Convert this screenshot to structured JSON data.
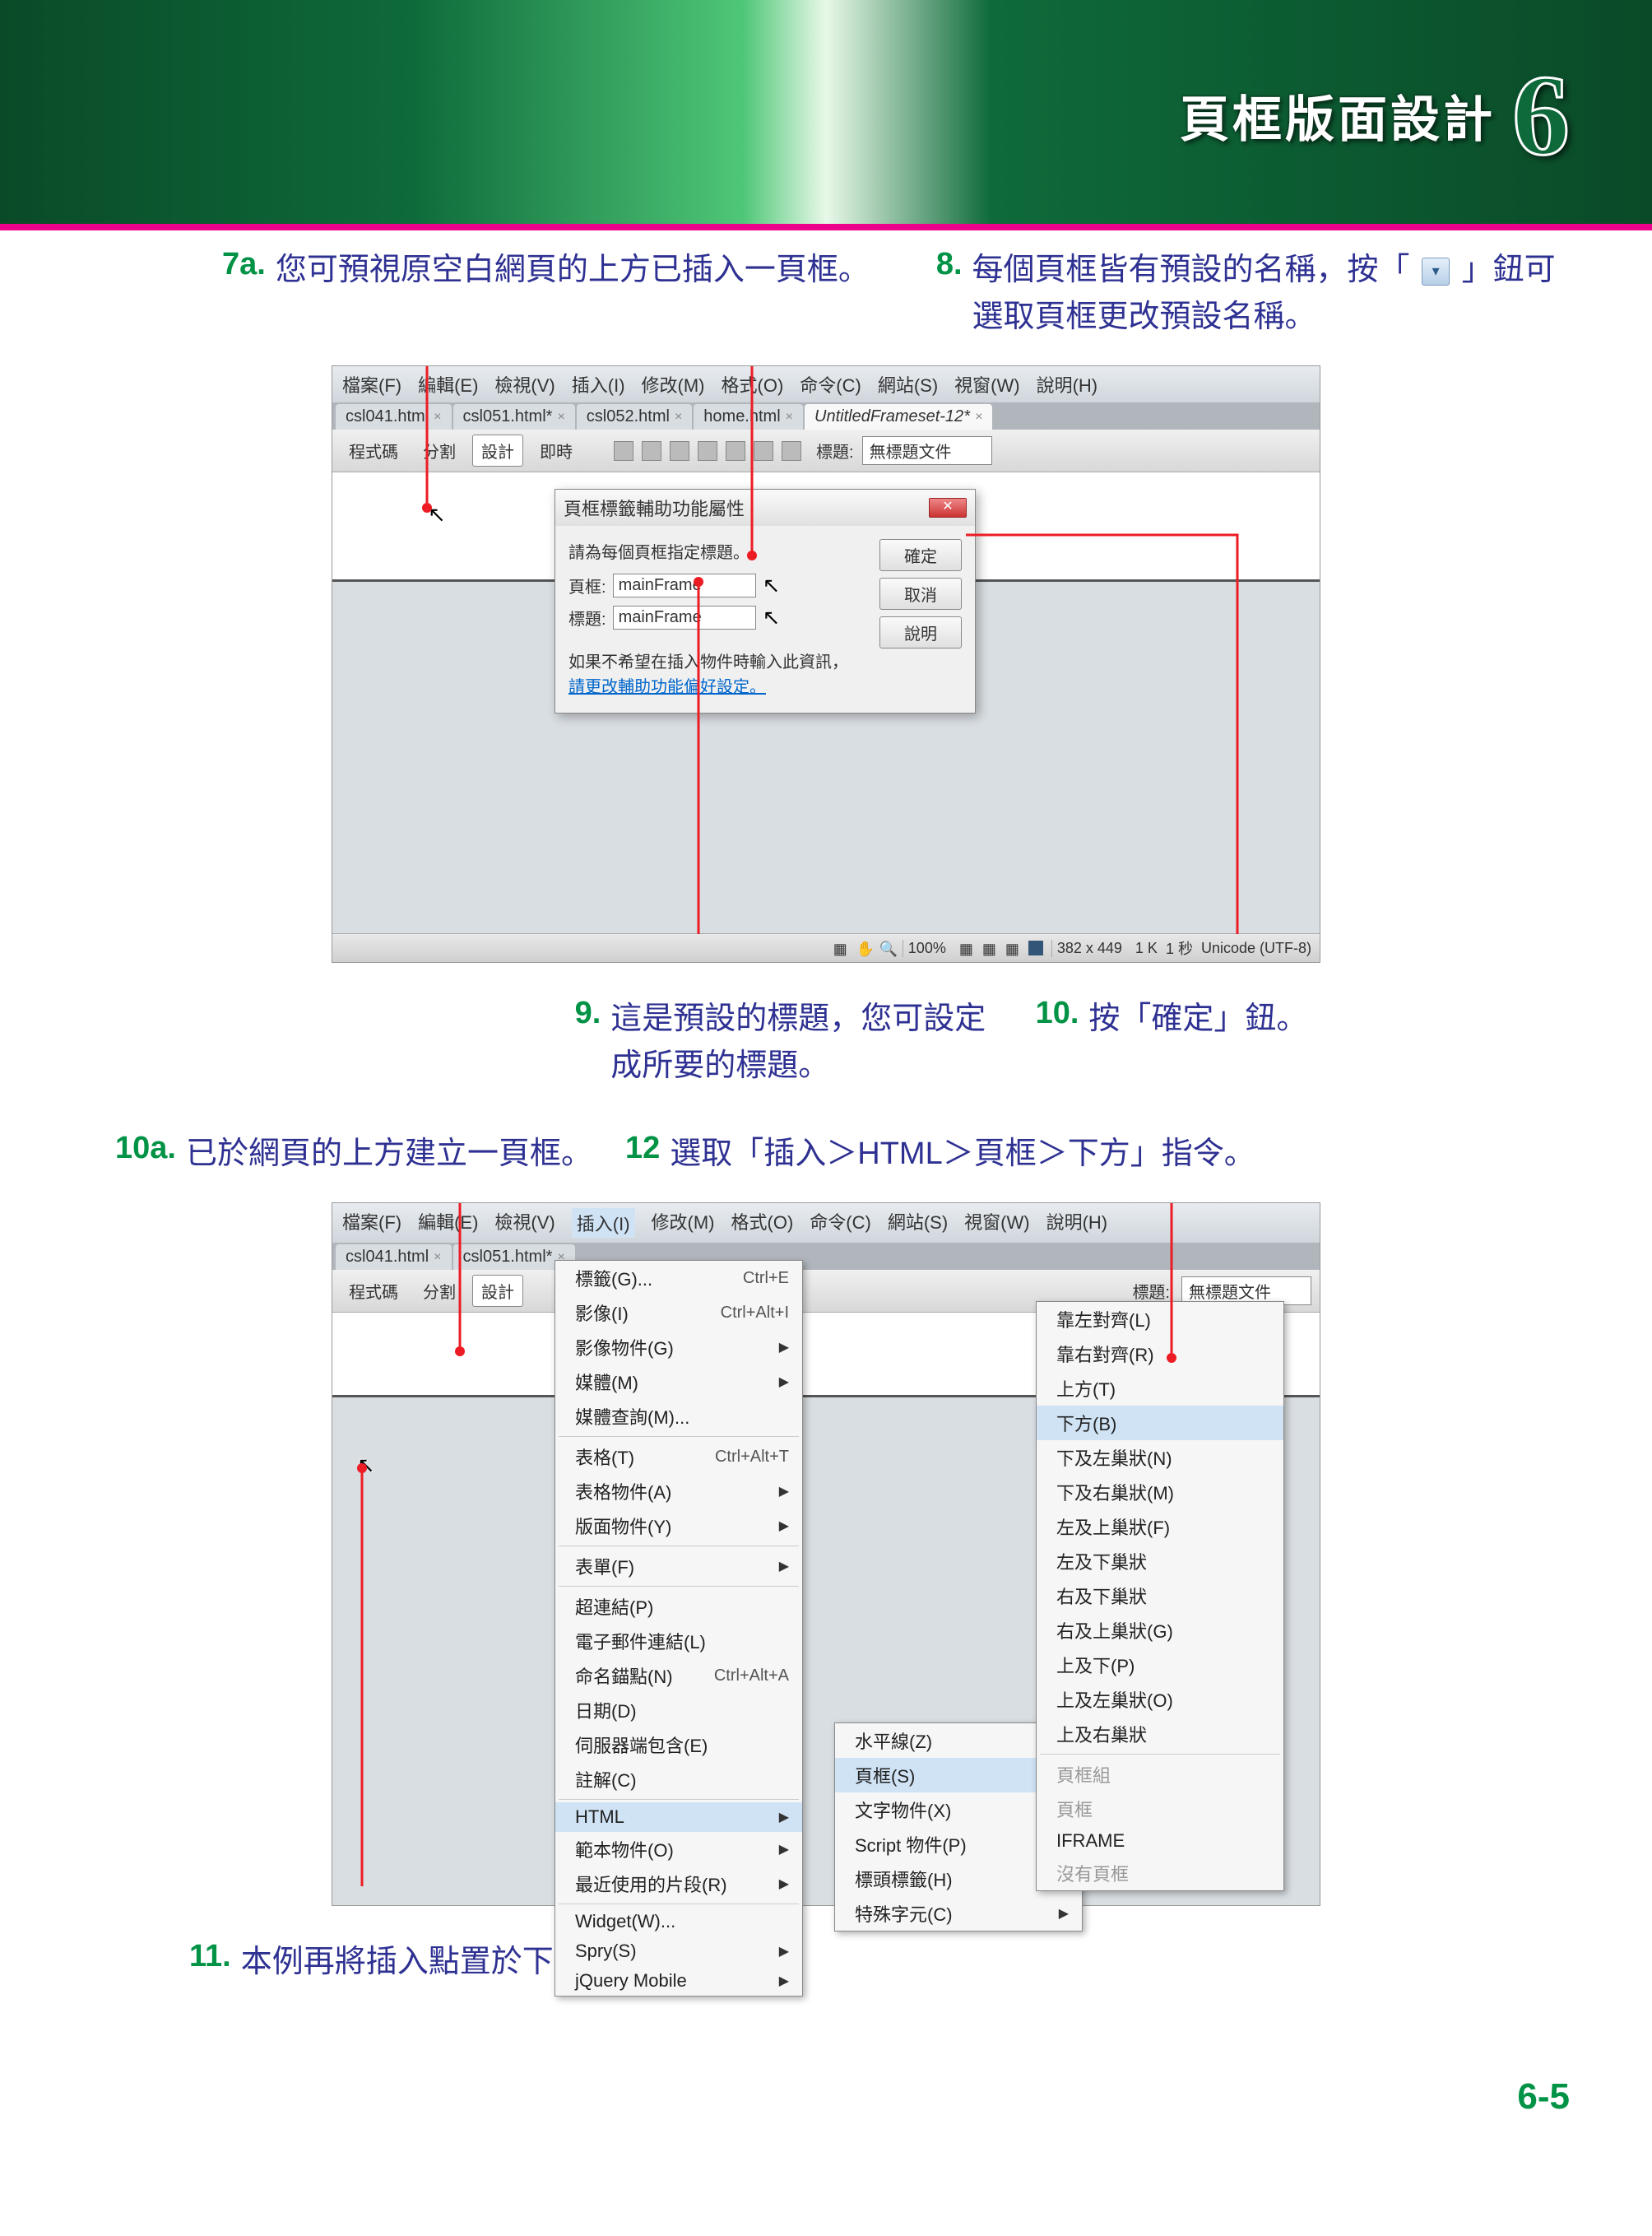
{
  "banner": {
    "title": "頁框版面設計",
    "chapter": "6"
  },
  "page_number": "6-5",
  "callouts": {
    "c7a": {
      "num": "7a.",
      "text": "您可預視原空白網頁的上方已插入一頁框。"
    },
    "c8": {
      "num": "8.",
      "text_before": "每個頁框皆有預設的名稱，按「",
      "text_after": "」鈕可選取頁框更改預設名稱。"
    },
    "c9": {
      "num": "9.",
      "text": "這是預設的標題，您可設定成所要的標題。"
    },
    "c10": {
      "num": "10.",
      "text": "按「確定」鈕。"
    },
    "c10a": {
      "num": "10a.",
      "text": "已於網頁的上方建立一頁框。"
    },
    "c11": {
      "num": "11.",
      "text": "本例再將插入點置於下方的頁框處。"
    },
    "c12": {
      "num": "12",
      "text": "選取「插入＞HTML＞頁框＞下方」指令。"
    }
  },
  "shot1": {
    "menubar": [
      "檔案(F)",
      "編輯(E)",
      "檢視(V)",
      "插入(I)",
      "修改(M)",
      "格式(O)",
      "命令(C)",
      "網站(S)",
      "視窗(W)",
      "說明(H)"
    ],
    "tabs": [
      "csl041.html",
      "csl051.html*",
      "csl052.html",
      "home.html"
    ],
    "active_tab": "UntitledFrameset-12*",
    "view_modes": {
      "code": "程式碼",
      "split": "分割",
      "design": "設計",
      "live": "即時"
    },
    "title_label": "標題:",
    "title_value": "無標題文件",
    "dialog": {
      "header": "頁框標籤輔助功能屬性",
      "instruction": "請為每個頁框指定標題。",
      "field_frame": "頁框:",
      "val_frame": "mainFrame",
      "field_title": "標題:",
      "val_title": "mainFrame",
      "note_before": "如果不希望在插入物件時輸入此資訊，",
      "note_link": "請更改輔助功能偏好設定。",
      "btn_ok": "確定",
      "btn_cancel": "取消",
      "btn_help": "說明"
    },
    "status": {
      "zoom": "100%",
      "dims": "382 x 449",
      "size": "1 K",
      "time": "1 秒",
      "encoding": "Unicode (UTF-8)"
    }
  },
  "shot2": {
    "menubar": [
      "檔案(F)",
      "編輯(E)",
      "檢視(V)",
      "插入(I)",
      "修改(M)",
      "格式(O)",
      "命令(C)",
      "網站(S)",
      "視窗(W)",
      "說明(H)"
    ],
    "tabs": [
      "csl041.html",
      "csl051.html*"
    ],
    "title_label": "標題:",
    "title_value": "無標題文件",
    "view_modes": {
      "code": "程式碼",
      "split": "分割",
      "design": "設計"
    },
    "insert_menu": [
      {
        "label": "標籤(G)...",
        "shortcut": "Ctrl+E"
      },
      {
        "label": "影像(I)",
        "shortcut": "Ctrl+Alt+I"
      },
      {
        "label": "影像物件(G)",
        "sub": true
      },
      {
        "label": "媒體(M)",
        "sub": true
      },
      {
        "label": "媒體查詢(M)..."
      },
      {
        "sep": true
      },
      {
        "label": "表格(T)",
        "shortcut": "Ctrl+Alt+T"
      },
      {
        "label": "表格物件(A)",
        "sub": true
      },
      {
        "label": "版面物件(Y)",
        "sub": true
      },
      {
        "sep": true
      },
      {
        "label": "表單(F)",
        "sub": true
      },
      {
        "sep": true
      },
      {
        "label": "超連結(P)"
      },
      {
        "label": "電子郵件連結(L)"
      },
      {
        "label": "命名錨點(N)",
        "shortcut": "Ctrl+Alt+A"
      },
      {
        "label": "日期(D)"
      },
      {
        "label": "伺服器端包含(E)"
      },
      {
        "label": "註解(C)"
      },
      {
        "sep": true
      },
      {
        "label": "HTML",
        "sub": true,
        "hover": true
      },
      {
        "label": "範本物件(O)",
        "sub": true
      },
      {
        "label": "最近使用的片段(R)",
        "sub": true
      },
      {
        "sep": true
      },
      {
        "label": "Widget(W)..."
      },
      {
        "label": "Spry(S)",
        "sub": true
      },
      {
        "label": "jQuery Mobile",
        "sub": true
      }
    ],
    "html_submenu": [
      {
        "label": "水平線(Z)"
      },
      {
        "label": "頁框(S)",
        "sub": true,
        "hover": true
      },
      {
        "label": "文字物件(X)",
        "sub": true
      },
      {
        "label": "Script 物件(P)",
        "sub": true
      },
      {
        "label": "標頭標籤(H)",
        "sub": true
      },
      {
        "label": "特殊字元(C)",
        "sub": true
      }
    ],
    "frame_submenu": [
      {
        "label": "靠左對齊(L)"
      },
      {
        "label": "靠右對齊(R)"
      },
      {
        "label": "上方(T)"
      },
      {
        "label": "下方(B)",
        "hover": true
      },
      {
        "label": "下及左巢狀(N)"
      },
      {
        "label": "下及右巢狀(M)"
      },
      {
        "label": "左及上巢狀(F)"
      },
      {
        "label": "左及下巢狀"
      },
      {
        "label": "右及下巢狀"
      },
      {
        "label": "右及上巢狀(G)"
      },
      {
        "label": "上及下(P)"
      },
      {
        "label": "上及左巢狀(O)"
      },
      {
        "label": "上及右巢狀"
      },
      {
        "sep": true
      },
      {
        "label": "頁框組",
        "disabled": true
      },
      {
        "label": "頁框",
        "disabled": true
      },
      {
        "label": "IFRAME"
      },
      {
        "label": "沒有頁框",
        "disabled": true
      }
    ]
  }
}
